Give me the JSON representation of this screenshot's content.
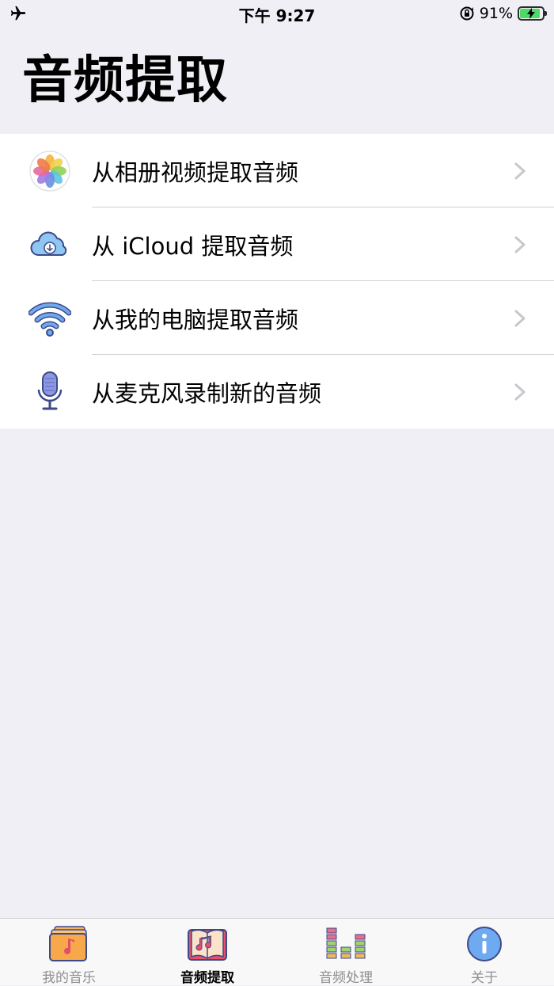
{
  "status_bar": {
    "time": "下午 9:27",
    "battery_percent": "91%",
    "battery_level": 0.91,
    "airplane_icon": "airplane-icon",
    "rotation_lock_icon": "rotation-lock-icon",
    "battery_icon": "battery-charging-icon"
  },
  "header": {
    "title": "音频提取"
  },
  "list": {
    "items": [
      {
        "label": "从相册视频提取音频",
        "icon": "photos-flower-icon"
      },
      {
        "label": "从 iCloud 提取音频",
        "icon": "cloud-download-icon"
      },
      {
        "label": "从我的电脑提取音频",
        "icon": "wifi-icon"
      },
      {
        "label": "从麦克风录制新的音频",
        "icon": "microphone-icon"
      }
    ]
  },
  "tabbar": {
    "tabs": [
      {
        "label": "我的音乐",
        "icon": "music-folder-icon",
        "active": false
      },
      {
        "label": "音频提取",
        "icon": "music-book-icon",
        "active": true
      },
      {
        "label": "音频处理",
        "icon": "equalizer-icon",
        "active": false
      },
      {
        "label": "关于",
        "icon": "info-icon",
        "active": false
      }
    ]
  },
  "colors": {
    "background": "#f0eff5",
    "battery_green": "#4cd964",
    "chevron": "#c7c7cc",
    "tab_inactive": "#8e8e93"
  }
}
